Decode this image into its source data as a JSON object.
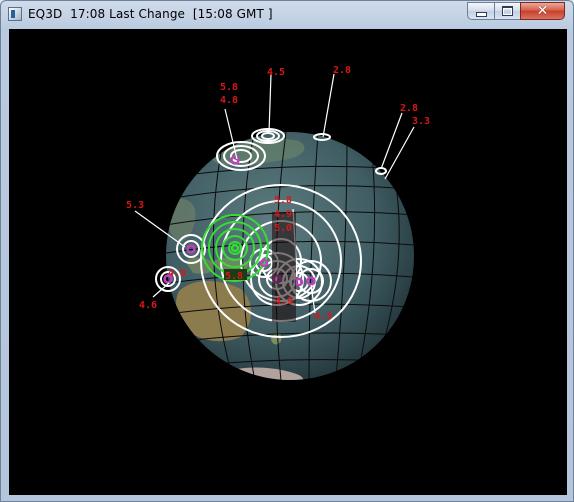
{
  "window": {
    "app_name": "EQ3D",
    "local_time": "17:08",
    "status": "Last Change",
    "gmt_label": "[15:08 GMT ]",
    "close_symbol": "✕"
  },
  "icons": {
    "app": "eq3d-app-icon",
    "minimize": "minimize-icon",
    "maximize": "maximize-icon",
    "close": "close-icon"
  },
  "colors": {
    "background": "#000000",
    "label_red": "#d81818",
    "ring_white": "#ffffff",
    "ring_green": "#33dd33",
    "ring_magenta": "#c040c0"
  },
  "quake_labels": [
    {
      "id": "q1",
      "text": "5.8"
    },
    {
      "id": "q2",
      "text": "4.8"
    },
    {
      "id": "q3",
      "text": "4.5"
    },
    {
      "id": "q4",
      "text": "2.8"
    },
    {
      "id": "q5",
      "text": "2.8"
    },
    {
      "id": "q6",
      "text": "3.3"
    },
    {
      "id": "q7",
      "text": "5.3"
    },
    {
      "id": "q8",
      "text": "5.8"
    },
    {
      "id": "q9",
      "text": "4.9"
    },
    {
      "id": "q10",
      "text": "5.0"
    },
    {
      "id": "q11",
      "text": "4.0"
    },
    {
      "id": "q12",
      "text": "5.8"
    },
    {
      "id": "q13",
      "text": "4.6"
    },
    {
      "id": "q14",
      "text": "4.9"
    },
    {
      "id": "q15",
      "text": "4.3"
    }
  ]
}
